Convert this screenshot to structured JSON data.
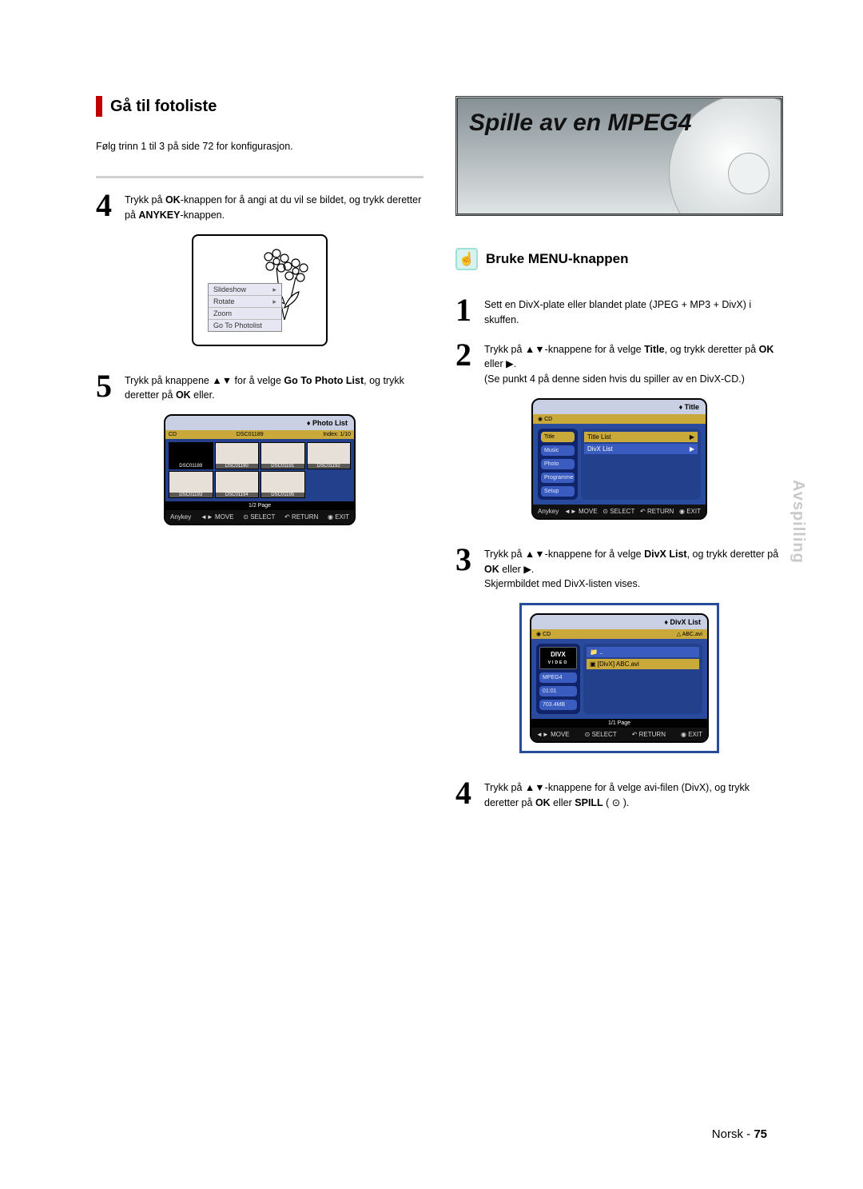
{
  "left": {
    "heading": "Gå til fotoliste",
    "intro": "Følg trinn 1 til 3 på side 72 for konfigurasjon.",
    "step4": {
      "num": "4",
      "text_pre": "Trykk på ",
      "bold1": "OK",
      "text_mid": "-knappen for å angi at du vil se bildet, og trykk deretter på ",
      "bold2": "ANYKEY",
      "text_post": "-knappen."
    },
    "context_menu": {
      "slideshow": "Slideshow",
      "rotate": "Rotate",
      "zoom": "Zoom",
      "goto": "Go To Photolist"
    },
    "step5": {
      "num": "5",
      "text_pre": "Trykk på knappene ▲▼ for å velge ",
      "bold1": "Go To Photo List",
      "text_mid": ", og trykk deretter på ",
      "bold2": "OK",
      "text_post": " eller."
    },
    "photo_osd": {
      "header": "Photo List",
      "top_left": "CD",
      "top_mid": "DSC01189",
      "top_right": "Index: 1/10",
      "thumbs": [
        "DSC01189",
        "DSC01190",
        "DSC01191",
        "DSC01192",
        "DSC01193",
        "DSC01194",
        "DSC01195"
      ],
      "page": "1/2 Page",
      "footer": {
        "anykey": "Anykey",
        "move": "MOVE",
        "select": "SELECT",
        "return": "RETURN",
        "exit": "EXIT"
      }
    }
  },
  "right": {
    "feature_title": "Spille av en MPEG4",
    "sub_heading": "Bruke MENU-knappen",
    "step1": {
      "num": "1",
      "text": "Sett en DivX-plate eller blandet plate (JPEG + MP3 + DivX) i skuffen."
    },
    "step2": {
      "num": "2",
      "text_pre": "Trykk på ▲▼-knappene for å velge ",
      "bold1": "Title",
      "text_mid1": ", og trykk deretter på ",
      "bold2": "OK",
      "text_mid2": " eller ▶.",
      "note": "(Se punkt 4 på denne siden hvis du spiller av en DivX-CD.)"
    },
    "title_osd": {
      "header": "Title",
      "top_left": "CD",
      "sidebar": [
        "Title",
        "Music",
        "Photo",
        "Programme",
        "Setup"
      ],
      "rows": [
        {
          "label": "Title List",
          "arrow": "▶"
        },
        {
          "label": "DivX List",
          "arrow": "▶"
        }
      ],
      "footer": {
        "anykey": "Anykey",
        "move": "MOVE",
        "select": "SELECT",
        "return": "RETURN",
        "exit": "EXIT"
      }
    },
    "step3": {
      "num": "3",
      "text_pre": "Trykk på ▲▼-knappene for å velge ",
      "bold1": "DivX List",
      "text_mid1": ", og trykk deretter på ",
      "bold2": "OK",
      "text_mid2": " eller ▶.",
      "note": "Skjermbildet med DivX-listen vises."
    },
    "divx_osd": {
      "header": "DivX List",
      "top_left": "CD",
      "top_right": "ABC.avi",
      "folder": "..",
      "file": "[DivX] ABC.avi",
      "mpeg4": "MPEG4",
      "time": "01:01",
      "size": "703.4MB",
      "page": "1/1 Page",
      "footer": {
        "move": "MOVE",
        "select": "SELECT",
        "return": "RETURN",
        "exit": "EXIT"
      }
    },
    "step4": {
      "num": "4",
      "text_pre": "Trykk på ▲▼-knappene for å velge avi-filen (DivX), og trykk deretter på ",
      "bold1": "OK",
      "text_mid": " eller ",
      "bold2": "SPILL",
      "text_post": " ( ⊙ )."
    }
  },
  "side_tab": "Avspilling",
  "footer": {
    "lang": "Norsk",
    "sep": " - ",
    "page": "75"
  }
}
